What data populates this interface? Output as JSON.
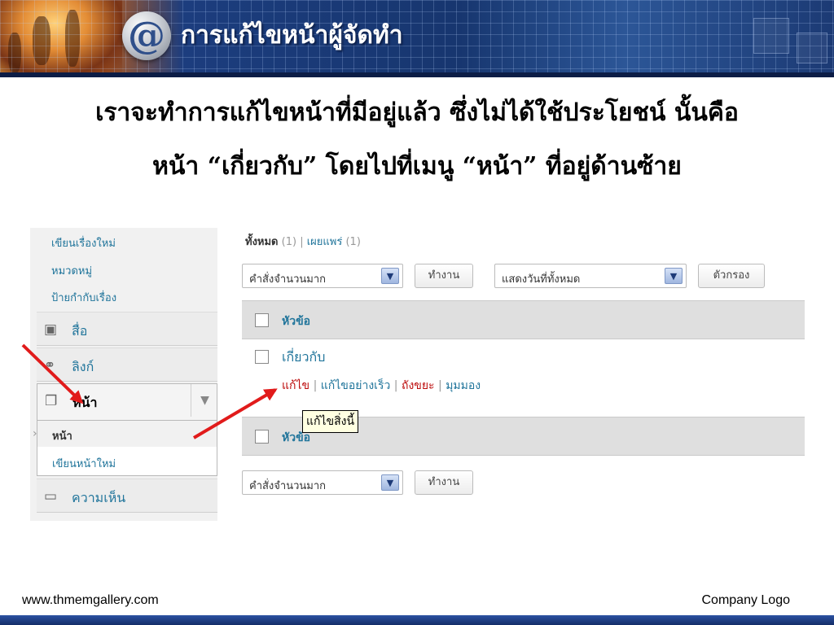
{
  "slide": {
    "title": "การแก้ไขหน้าผู้จัดทำ",
    "logo_text": "@",
    "body_lines": [
      "เราจะทำการแก้ไขหน้าที่มีอยู่แล้ว ซึ่งไม่ได้ใช้ประโยชน์ นั้นคือ",
      "หน้า “เกี่ยวกับ” โดยไปที่เมนู “หน้า” ที่อยู่ด้านซ้าย"
    ],
    "footer_url": "www.thmemgallery.com",
    "footer_logo": "Company Logo"
  },
  "sidebar": {
    "post_links": [
      "เขียนเรื่องใหม่",
      "หมวดหมู่",
      "ป้ายกำกับเรื่อง"
    ],
    "media": "สื่อ",
    "links": "ลิงก์",
    "pages": "หน้า",
    "pages_toggle": "▼",
    "submenu_current": "หน้า",
    "submenu_new": "เขียนหน้าใหม่",
    "comments": "ความเห็น"
  },
  "main": {
    "filter_all": "ทั้งหมด",
    "filter_all_count": "(1)",
    "filter_sep": "|",
    "filter_published": "เผยแพร่",
    "filter_published_count": "(1)",
    "bulk_select": "คำสั่งจำนวนมาก",
    "apply_button": "ทำงาน",
    "date_select": "แสดงวันที่ทั้งหมด",
    "filter_button": "ตัวกรอง",
    "column_title": "หัวข้อ",
    "page_title": "เกี่ยวกับ",
    "action_edit": "แก้ไข",
    "action_quick_edit": "แก้ไขอย่างเร็ว",
    "action_trash": "ถังขยะ",
    "action_view": "มุมมอง",
    "action_sep": "|",
    "tooltip": "แก้ไขสิ่งนี้"
  },
  "icons": {
    "media": "media-icon",
    "links": "link-icon",
    "pages": "pages-icon",
    "comments": "comment-icon",
    "arrow_color": "#e11b1b"
  }
}
